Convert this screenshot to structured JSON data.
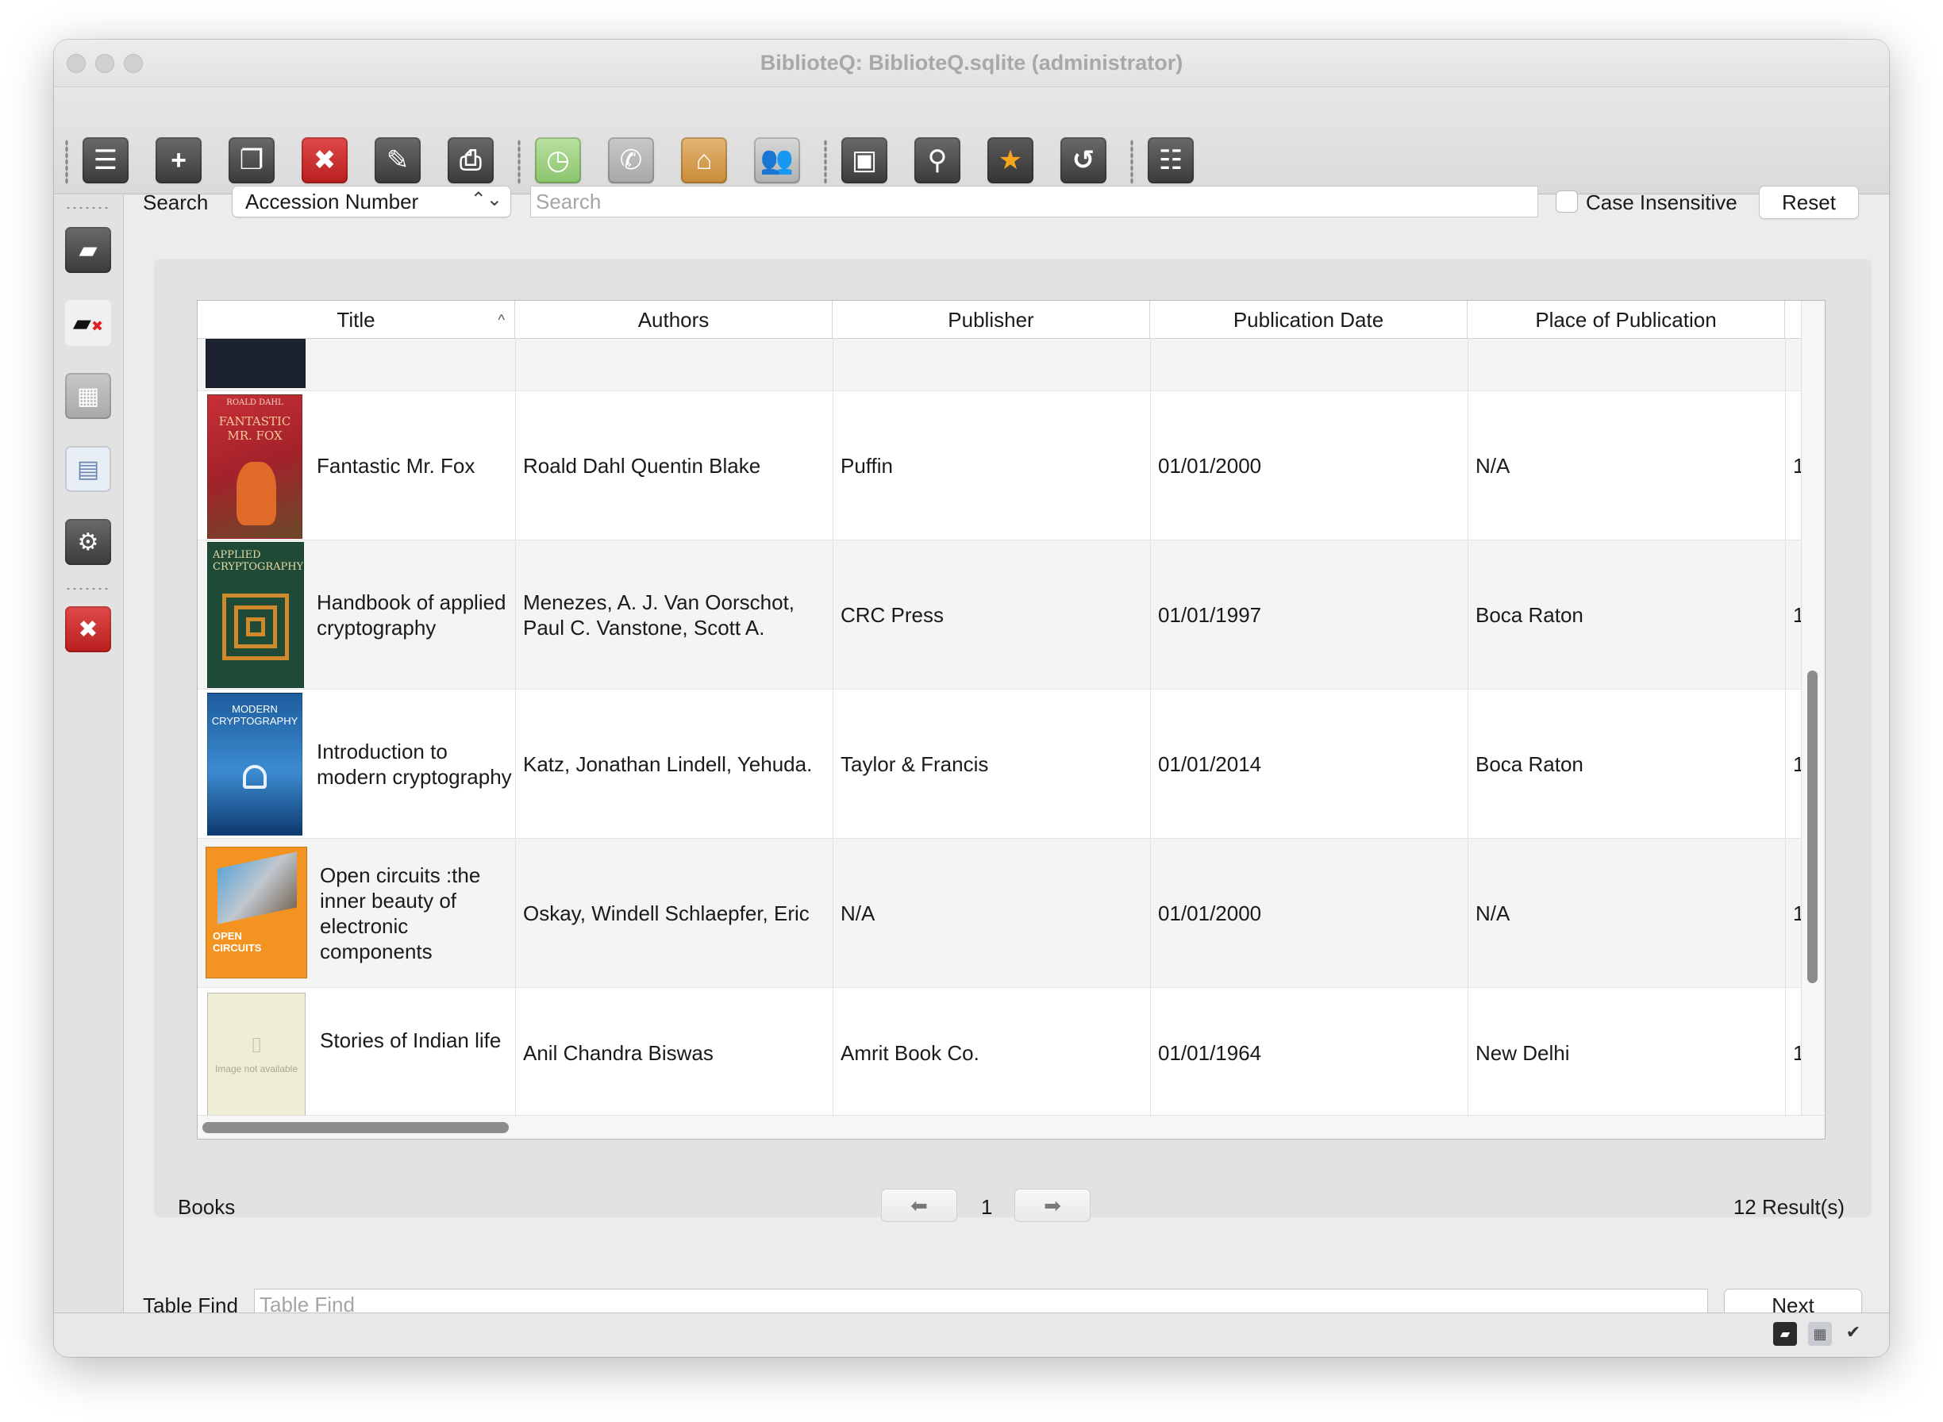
{
  "window": {
    "title": "BiblioteQ: BiblioteQ.sqlite (administrator)"
  },
  "toolbar": {
    "icons": [
      "list-icon",
      "add-icon",
      "duplicate-icon",
      "delete-icon",
      "modify-icon",
      "print-icon",
      "history-icon",
      "phone-icon",
      "home-icon",
      "members-icon",
      "copies-icon",
      "search-icon",
      "favorite-icon",
      "refresh-icon",
      "details-icon"
    ]
  },
  "sidebar": {
    "icons": [
      "connect-icon",
      "disconnect-icon",
      "calculator-icon",
      "id-card-icon",
      "settings-icon",
      "exit-icon"
    ]
  },
  "search": {
    "label": "Search",
    "field_value": "Accession Number",
    "combo_arrows": "⌃⌄",
    "placeholder": "Search",
    "case_insensitive": "Case Insensitive",
    "reset": "Reset"
  },
  "table": {
    "columns": [
      "Title",
      "Authors",
      "Publisher",
      "Publication Date",
      "Place of Publication"
    ],
    "sort_indicator": "^",
    "rows": [
      {
        "title": "",
        "authors": "",
        "publisher": "",
        "date": "",
        "place": "",
        "extra": ""
      },
      {
        "title": "Fantastic Mr. Fox",
        "authors": "Roald Dahl Quentin Blake",
        "publisher": "Puffin",
        "date": "01/01/2000",
        "place": "N/A",
        "extra": "1"
      },
      {
        "title": "Handbook of applied cryptography",
        "authors": "Menezes, A. J. Van Oorschot, Paul C. Vanstone, Scott A.",
        "publisher": "CRC Press",
        "date": "01/01/1997",
        "place": "Boca Raton",
        "extra": "1"
      },
      {
        "title": "Introduction to modern cryptography",
        "authors": "Katz, Jonathan Lindell, Yehuda.",
        "publisher": "Taylor & Francis",
        "date": "01/01/2014",
        "place": "Boca Raton",
        "extra": "1"
      },
      {
        "title": "Open circuits :the inner beauty of electronic components",
        "authors": "Oskay, Windell Schlaepfer, Eric",
        "publisher": "N/A",
        "date": "01/01/2000",
        "place": "N/A",
        "extra": "1"
      },
      {
        "title": "Stories of Indian life",
        "authors": "Anil Chandra Biswas",
        "publisher": "Amrit Book Co.",
        "date": "01/01/1964",
        "place": "New Delhi",
        "extra": "1"
      }
    ],
    "covers": {
      "fox": {
        "top": "ROALD DAHL",
        "title": "FANTASTIC MR. FOX"
      },
      "handbook": {
        "title": "APPLIED CRYPTOGRAPHY"
      },
      "intro": {
        "title": "MODERN CRYPTOGRAPHY"
      },
      "open": {
        "title": "OPEN CIRCUITS"
      },
      "placeholder": {
        "text": "Image not available"
      }
    }
  },
  "pager": {
    "category": "Books",
    "page": "1",
    "results": "12 Result(s)",
    "prev_glyph": "⬅",
    "next_glyph": "➡"
  },
  "find": {
    "label": "Table Find",
    "placeholder": "Table Find",
    "next": "Next"
  },
  "status": {
    "icons": [
      "connected-icon",
      "calculator-icon",
      "checkmark-icon"
    ],
    "check": "✔"
  }
}
